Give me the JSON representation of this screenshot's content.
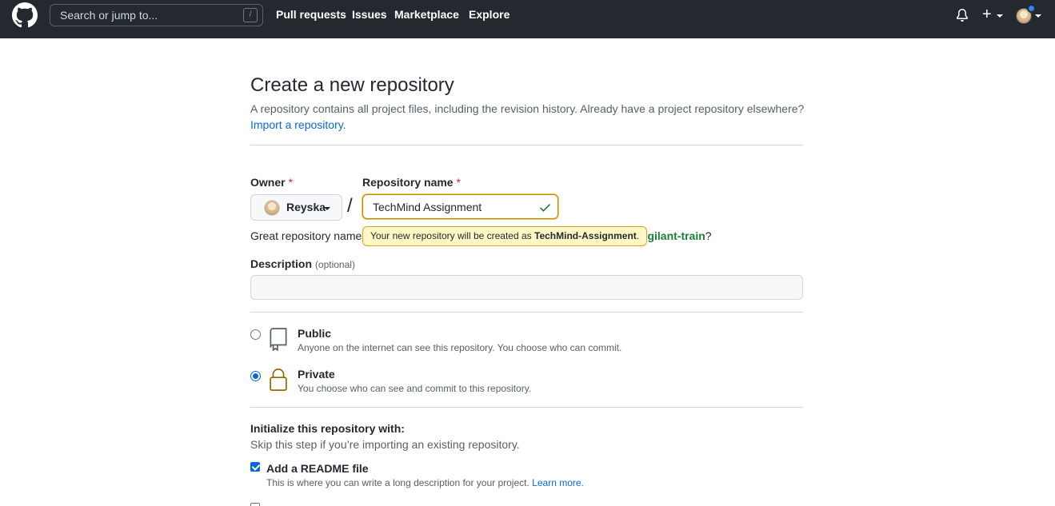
{
  "header": {
    "search_placeholder": "Search or jump to...",
    "search_shortcut": "/",
    "nav": [
      "Pull requests",
      "Issues",
      "Marketplace",
      "Explore"
    ],
    "icons": [
      "github-logo-icon",
      "bell-icon",
      "plus-icon",
      "avatar"
    ]
  },
  "page": {
    "title": "Create a new repository",
    "subtitle": "A repository contains all project files, including the revision history. Already have a project repository elsewhere?",
    "import_link": "Import a repository."
  },
  "form": {
    "owner_label": "Owner",
    "required_mark": "*",
    "owner_value": "Reyska",
    "separator": "/",
    "repo_name_label": "Repository name",
    "repo_name_value": "TechMind Assignment",
    "hint_prefix": "Great repository names",
    "suggestion_tail": "t",
    "suggestion_name": "vigilant-train",
    "suggestion_end": "?",
    "tooltip_prefix": "Your new repository will be created as",
    "tooltip_name": "TechMind-Assignment",
    "tooltip_suffix": ".",
    "description_label": "Description",
    "description_optional": "(optional)",
    "description_value": ""
  },
  "visibility": {
    "selected": "Private",
    "options": [
      {
        "title": "Public",
        "desc": "Anyone on the internet can see this repository. You choose who can commit.",
        "icon": "repo-icon"
      },
      {
        "title": "Private",
        "desc": "You choose who can see and commit to this repository.",
        "icon": "lock-icon"
      }
    ]
  },
  "initialize": {
    "title": "Initialize this repository with:",
    "subtitle": "Skip this step if you’re importing an existing repository.",
    "readme_checked": true,
    "readme_title": "Add a README file",
    "readme_desc": "This is where you can write a long description for your project.",
    "learn_more": "Learn more."
  },
  "colors": {
    "header_bg": "#24292f",
    "link": "#0969da",
    "success": "#1a7f37",
    "tooltip_bg": "#fff8c5",
    "required": "#cf222e",
    "lock_icon": "#9a6700"
  }
}
